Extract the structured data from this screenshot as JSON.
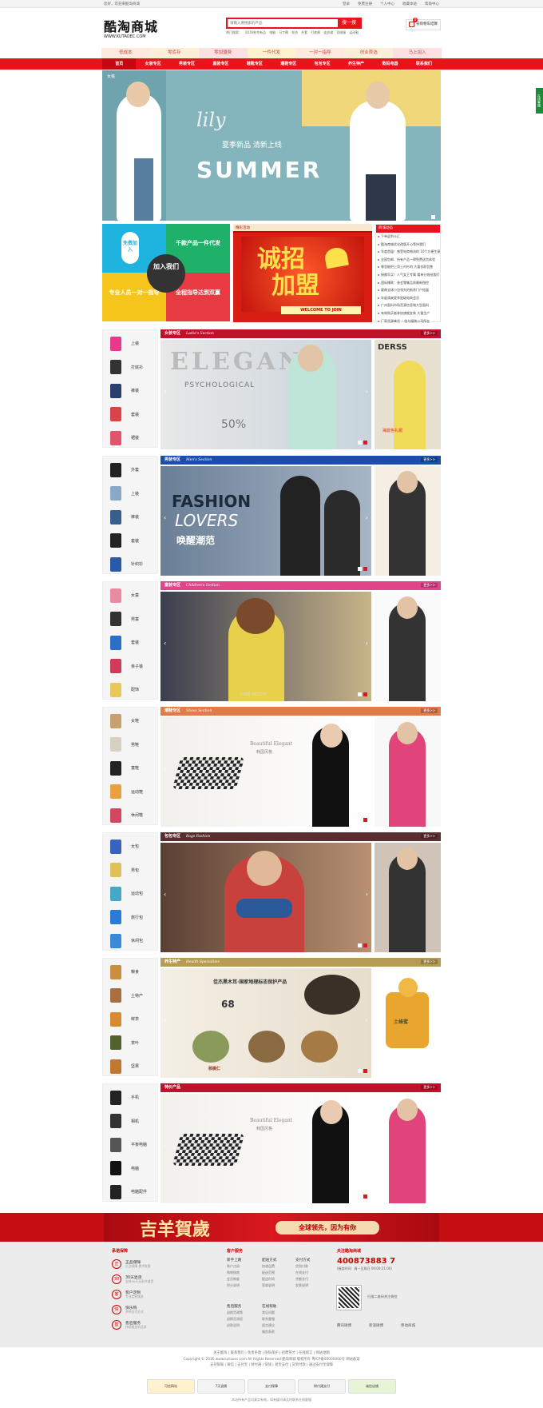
{
  "top": {
    "welcome": "您好，欢迎来酷淘商城",
    "links": [
      "登录",
      "免费注册",
      "个人中心",
      "收藏本站",
      "帮助中心"
    ]
  },
  "logo": {
    "cn": "酷淘商城",
    "en": "WWW.KUTAOEC.COM"
  },
  "search": {
    "placeholder": "请输入要搜索的产品",
    "button": "搜一搜",
    "hot_label": "热门搜索：",
    "hot": [
      "2016秋冬新品",
      "电脑",
      "马丁靴",
      "毛衣",
      "外套",
      "打底裤",
      "连衣裙",
      "羽绒服",
      "运动鞋"
    ]
  },
  "cart": {
    "label": "去购物车结算",
    "count": "0"
  },
  "tags": [
    "低成本",
    "零库存",
    "零加盟费",
    "一件代发",
    "一对一指导",
    "创业首选",
    "马上加入"
  ],
  "nav": [
    "首页",
    "女装专区",
    "男装专区",
    "童装专区",
    "鞋靴专区",
    "潮鞋专区",
    "包包专区",
    "养生特产",
    "数码电器",
    "联系我们"
  ],
  "banner": {
    "label": "女装",
    "script": "lily",
    "title": "夏季新品 清新上线",
    "big": "SUMMER"
  },
  "promo": {
    "a": "免费加入",
    "b": "千款产品一件代发",
    "c": "专业人员一对一指导",
    "d": "全程指导达到双赢",
    "center": "加入我们"
  },
  "ban2": {
    "tab": "精彩活动",
    "title1": "诚招",
    "title2": "加盟",
    "welcome": "WELCOME TO JOIN"
  },
  "news": {
    "title": "商城动态",
    "items": [
      "下单返利卡汇",
      "酷淘商城优化改版开心等待我们",
      "年度首届！感受电商物流的 10个方便生意",
      "全国包邮、所有产品一律免费送货体验",
      "哪里能把上男士衬衫的 大量衣款包售",
      "接搬早买！人气女王专属 看单分钱给我们",
      "国际爆款：参会零集品质最新指控",
      "要做全球小包领先的新贵门户拓展",
      "年度清爽夏季星级电商会员",
      "广州面料市场货源信息城大型面料",
      "有效购买者参加旗舰女装 大量生产",
      "厂家货源拿货 ：给与服装公司所在",
      "当年采取服务实施的特价销售"
    ]
  },
  "sections": [
    {
      "label": "女装专区",
      "sub": "Ladie's Section",
      "color": "#c0102a",
      "items": [
        "上装",
        "打底衫",
        "裤装",
        "套装",
        "裙装"
      ],
      "main_text": "ELEGANT",
      "main_sub": "PSYCHOLOGICAL",
      "main_pct": "50%",
      "aside_text": "DERSS",
      "aside_sub": "海蓝色礼裙"
    },
    {
      "label": "男装专区",
      "sub": "Men's Section",
      "color": "#1a4ea8",
      "items": [
        "外套",
        "上装",
        "裤装",
        "套装",
        "针织衫"
      ],
      "main_text": "FASHION",
      "main_sub": "LOVERS",
      "main_pct": "唤醒潮范",
      "aside_text": "",
      "aside_sub": ""
    },
    {
      "label": "童装专区",
      "sub": "Children's Section",
      "color": "#e0448a",
      "items": [
        "女童",
        "男童",
        "套装",
        "亲子装",
        "配饰"
      ],
      "main_text": "",
      "main_sub": "LURE SOUTH",
      "main_pct": "",
      "aside_text": "",
      "aside_sub": ""
    },
    {
      "label": "潮鞋专区",
      "sub": "Shoes Section",
      "color": "#e27a4a",
      "items": [
        "女鞋",
        "男鞋",
        "童鞋",
        "运动鞋",
        "休闲鞋"
      ],
      "main_text": "Beautiful Elegant",
      "main_sub": "韩国风格",
      "main_pct": "",
      "aside_text": "",
      "aside_sub": ""
    },
    {
      "label": "包包专区",
      "sub": "Bags Fashion",
      "color": "#5a2e2e",
      "items": [
        "女包",
        "男包",
        "运动包",
        "旅行包",
        "休闲包"
      ],
      "main_text": "",
      "main_sub": "",
      "main_pct": "",
      "aside_text": "",
      "aside_sub": ""
    },
    {
      "label": "养生特产",
      "sub": "Health Specialties",
      "color": "#b79b53",
      "items": [
        "粮食",
        "土特产",
        "鲜茶",
        "茶叶",
        "坚果"
      ],
      "main_text": "佳杰黑木耳·国家地理标志保护产品",
      "main_sub": "核桃仁",
      "main_pct": "68",
      "aside_text": "",
      "aside_sub": "土蜂蜜"
    },
    {
      "label": "特价产品",
      "sub": "",
      "color": "#c0102a",
      "items": [
        "手机",
        "相机",
        "平板电脑",
        "电脑",
        "电脑配件"
      ],
      "main_text": "Beautiful Elegant",
      "main_sub": "韩国风格",
      "main_pct": "",
      "aside_text": "",
      "aside_sub": ""
    }
  ],
  "more": "更多>>",
  "lunar": {
    "title": "吉羊賀歲",
    "slogan": "全球领先，因为有你"
  },
  "footer": {
    "guarantee": {
      "title": "承诺保障",
      "items": [
        "正品保障",
        "30天退货",
        "客户定制",
        "快乐购",
        "售后服务"
      ],
      "subs": [
        "正品保障 提供发票",
        "支持30天无条件退货",
        "专业定制服务",
        "多种支付方式",
        "持续稳定的品质"
      ]
    },
    "service": {
      "title": "客户服务",
      "cols": [
        [
          "新手上路",
          "账户注册",
          "购物指南",
          "会员制度",
          "积分说明"
        ],
        [
          "配送方式",
          "快递运费",
          "配送范围",
          "配送时间",
          "签收说明"
        ],
        [
          "支付方式",
          "货到付款",
          "在线支付",
          "余额支付",
          "发票说明"
        ]
      ],
      "cols2": [
        [
          "售后服务",
          "退换货政策",
          "退换货流程",
          "退款说明"
        ],
        [
          "在线帮助",
          "常见问题",
          "联系客服",
          "留言建议",
          "服务条款"
        ]
      ]
    },
    "contact": {
      "title": "关注酷淘商城",
      "phone": "400873883 7",
      "time": "(服务时间：周一至周日 09:00-21:00)",
      "wx": "扫描二维码关注微信",
      "s1": "腾讯微博",
      "s2": "新浪微博",
      "s3": "移动商城"
    }
  },
  "copyright": [
    "关于酷淘 | 联系我们 | 免责条款 | 隐私保护 | 招聘英才 | 在线留言 | 网站地图",
    "Copyright © 2016 www.kutaoec.com All Rights Reserved 酷淘商城 版权所有 粤ICP备00000000号 网站备案",
    "支持银联 | 微信 | 支付宝 | 财付通 | 快钱 | 易宝支付 | 货到付款 | 通过支付宝保障"
  ],
  "badges": [
    "可信网站",
    "7天退换",
    "支付保障",
    "财付通支付",
    "诚信店铺"
  ],
  "bottom": "本站所有产品均真实有效，如有疑问请及时联系在线客服"
}
